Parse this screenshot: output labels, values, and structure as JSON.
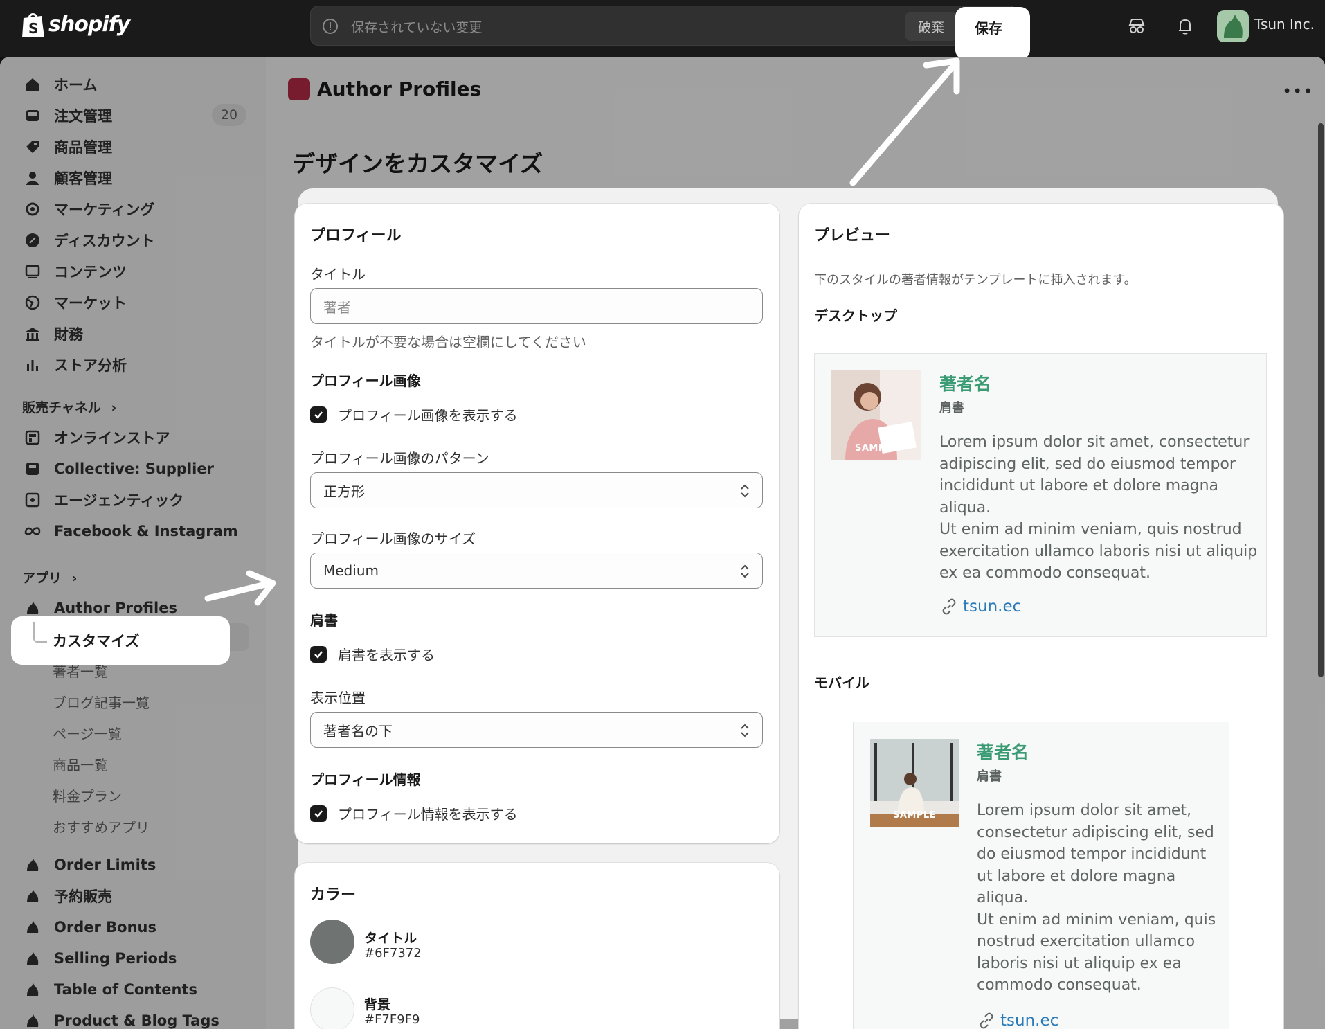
{
  "brand": {
    "logo_text": "shopify"
  },
  "savebar": {
    "message": "保存されていない変更",
    "discard_label": "破棄",
    "save_label": "保存"
  },
  "topbar": {
    "store_name": "Tsun Inc."
  },
  "sidebar": {
    "items": [
      {
        "label": "ホーム",
        "icon": "home-icon"
      },
      {
        "label": "注文管理",
        "icon": "inbox-icon",
        "badge": "20"
      },
      {
        "label": "商品管理",
        "icon": "tag-icon"
      },
      {
        "label": "顧客管理",
        "icon": "person-icon"
      },
      {
        "label": "マーケティング",
        "icon": "target-icon"
      },
      {
        "label": "ディスカウント",
        "icon": "discount-icon"
      },
      {
        "label": "コンテンツ",
        "icon": "image-icon"
      },
      {
        "label": "マーケット",
        "icon": "globe-icon"
      },
      {
        "label": "財務",
        "icon": "bank-icon"
      },
      {
        "label": "ストア分析",
        "icon": "chart-icon"
      }
    ],
    "sales_channels_label": "販売チャネル",
    "channels": [
      {
        "label": "オンラインストア"
      },
      {
        "label": "Collective: Supplier"
      },
      {
        "label": "エージェンティック"
      },
      {
        "label": "Facebook & Instagram"
      }
    ],
    "apps_label": "アプリ",
    "app_name": "Author Profiles",
    "app_subitems": [
      "カスタマイズ",
      "著者一覧",
      "ブログ記事一覧",
      "ページ一覧",
      "商品一覧",
      "料金プラン",
      "おすすめアプリ"
    ],
    "other_apps": [
      "Order Limits",
      "予約販売",
      "Order Bonus",
      "Selling Periods",
      "Table of Contents",
      "Product & Blog Tags"
    ]
  },
  "page": {
    "app_title": "Author Profiles",
    "title": "デザインをカスタマイズ"
  },
  "profile_card": {
    "title": "プロフィール",
    "title_label": "タイトル",
    "title_placeholder": "著者",
    "title_help": "タイトルが不要な場合は空欄にしてください",
    "image_heading": "プロフィール画像",
    "image_checkbox": "プロフィール画像を表示する",
    "pattern_label": "プロフィール画像のパターン",
    "pattern_value": "正方形",
    "size_label": "プロフィール画像のサイズ",
    "size_value": "Medium",
    "role_heading": "肩書",
    "role_checkbox": "肩書を表示する",
    "position_label": "表示位置",
    "position_value": "著者名の下",
    "info_heading": "プロフィール情報",
    "info_checkbox": "プロフィール情報を表示する"
  },
  "color_card": {
    "title": "カラー",
    "colors": [
      {
        "label": "タイトル",
        "value": "#6F7372"
      },
      {
        "label": "背景",
        "value": "#F7F9F9"
      }
    ]
  },
  "preview": {
    "title": "プレビュー",
    "description": "下のスタイルの著者情報がテンプレートに挿入されます。",
    "desktop_label": "デスクトップ",
    "mobile_label": "モバイル",
    "author_name": "著者名",
    "author_role": "肩書",
    "sample_label": "SAMPLE",
    "bio_desktop": [
      "Lorem ipsum dolor sit amet, consectetur",
      "adipiscing elit, sed do eiusmod tempor",
      "incididunt ut labore et dolore magna",
      "aliqua.",
      "Ut enim ad minim veniam, quis nostrud",
      "exercitation ullamco laboris nisi ut aliquip",
      "ex ea commodo consequat."
    ],
    "bio_mobile": [
      "Lorem ipsum dolor sit amet,",
      "consectetur adipiscing elit, sed",
      "do eiusmod tempor incididunt",
      "ut labore et dolore magna",
      "aliqua.",
      "Ut enim ad minim veniam, quis",
      "nostrud exercitation ullamco",
      "laboris nisi ut aliquip ex ea",
      "commodo consequat."
    ],
    "link": "tsun.ec"
  },
  "colors": {
    "accent_name": "#3a9b74",
    "link": "#2a7ab8",
    "app_icon": "#b12a45"
  }
}
